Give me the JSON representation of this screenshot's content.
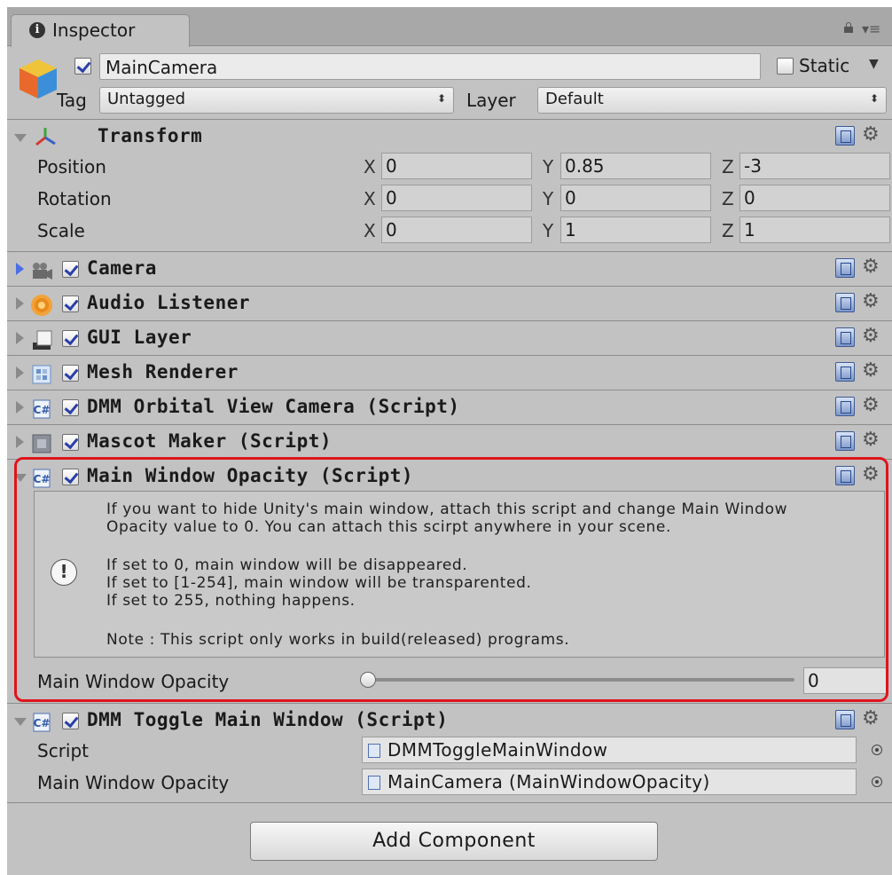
{
  "tab": {
    "label": "Inspector"
  },
  "header": {
    "object_name": "MainCamera",
    "static_label": "Static",
    "tag_label": "Tag",
    "tag_value": "Untagged",
    "layer_label": "Layer",
    "layer_value": "Default",
    "active": true,
    "is_static": false
  },
  "transform": {
    "title": "Transform",
    "rows": [
      {
        "label": "Position",
        "x": "0",
        "y": "0.85",
        "z": "-3"
      },
      {
        "label": "Rotation",
        "x": "0",
        "y": "0",
        "z": "0"
      },
      {
        "label": "Scale",
        "x": "0",
        "y": "1",
        "z": "1"
      }
    ],
    "axes": {
      "x": "X",
      "y": "Y",
      "z": "Z"
    }
  },
  "components": [
    {
      "title": "Camera",
      "icon": "camera-icon",
      "enabled": true
    },
    {
      "title": "Audio Listener",
      "icon": "audio-listener-icon",
      "enabled": true
    },
    {
      "title": "GUI Layer",
      "icon": "gui-layer-icon",
      "enabled": true
    },
    {
      "title": "Mesh Renderer",
      "icon": "mesh-renderer-icon",
      "enabled": true
    },
    {
      "title": "DMM Orbital View Camera (Script)",
      "icon": "script-icon",
      "enabled": true
    },
    {
      "title": "Mascot Maker (Script)",
      "icon": "script-gray-icon",
      "enabled": true
    }
  ],
  "opacity_component": {
    "title": "Main Window Opacity (Script)",
    "help_lines": [
      "If you want to hide Unity's main window, attach this script and change Main Window",
      "Opacity value to 0. You can attach this scirpt anywhere in your scene.",
      "If set to 0, main window will be disappeared.",
      "If set to [1-254], main window will be transparented.",
      "If set to 255, nothing happens.",
      "Note : This script only works in build(released) programs."
    ],
    "field_label": "Main Window Opacity",
    "field_value": "0",
    "slider_fraction": 0
  },
  "toggle_component": {
    "title": "DMM Toggle Main Window (Script)",
    "script_label": "Script",
    "script_value": "DMMToggleMainWindow",
    "opacity_label": "Main Window Opacity",
    "opacity_value": "MainCamera (MainWindowOpacity)"
  },
  "add_component_label": "Add Component",
  "colors": {
    "highlight": "#e0141c",
    "panel": "#c2c2c2",
    "check": "#2a3ea8"
  }
}
